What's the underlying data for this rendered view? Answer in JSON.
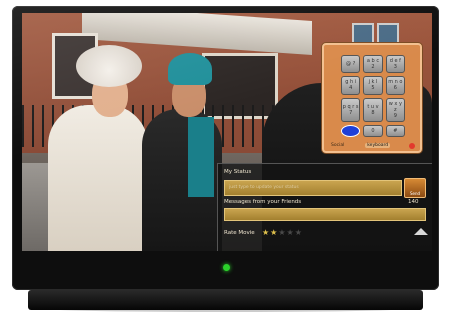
{
  "keypad": {
    "keys": [
      {
        "label": "@ ?"
      },
      {
        "label": "a b c\n2"
      },
      {
        "label": "d e f\n3"
      },
      {
        "label": "g h i\n4"
      },
      {
        "label": "j k l\n5"
      },
      {
        "label": "m n o\n6"
      },
      {
        "label": "p q r s\n7"
      },
      {
        "label": "t u v\n8"
      },
      {
        "label": "w x y z\n9"
      },
      {
        "label": ""
      },
      {
        "label": "0"
      },
      {
        "label": "#"
      }
    ],
    "tabs": [
      {
        "label": "Social"
      },
      {
        "label": "keyboard"
      }
    ]
  },
  "panel": {
    "my_status_label": "My Status",
    "status_placeholder": "just type to update your status",
    "send_label": "Send",
    "messages_label": "Messages from your Friends",
    "message_count": "140",
    "rate_label": "Rate Movie",
    "rating": 2,
    "rating_max": 5
  },
  "colors": {
    "keypad_bg": "#d98a4b",
    "panel_bg": "#141414",
    "field_gold": "#c9a44f",
    "selected_key": "#1e3fd8",
    "power_led": "#2bd22b"
  }
}
